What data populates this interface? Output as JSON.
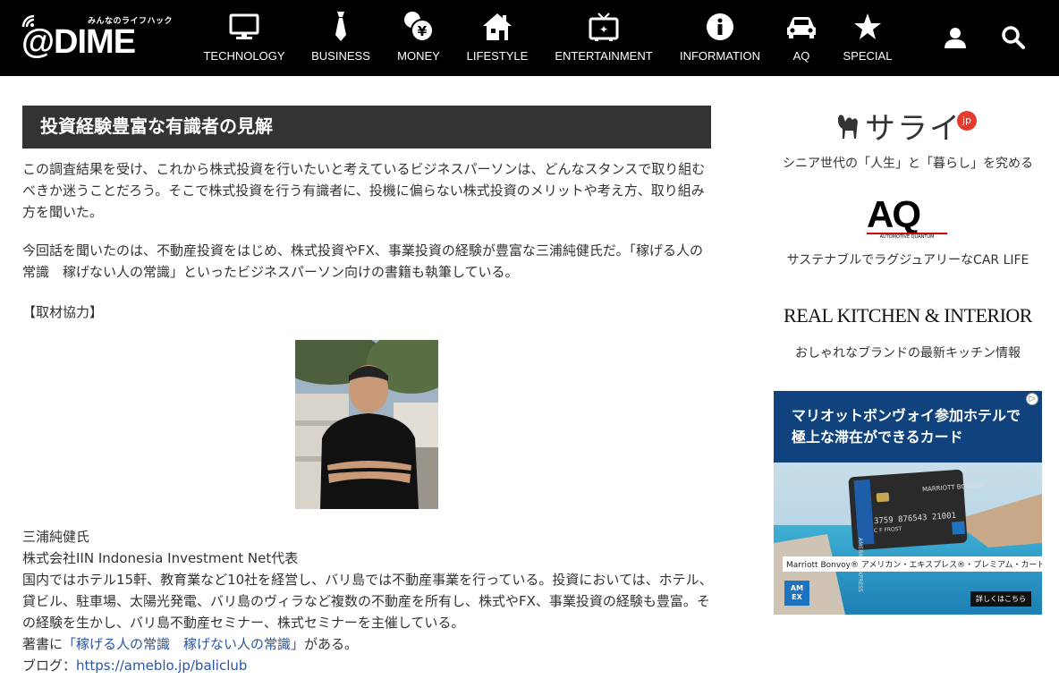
{
  "header": {
    "logo_tagline": "みんなのライフハック",
    "logo_text": "@DIME",
    "nav": [
      {
        "label": "TECHNOLOGY",
        "icon": "monitor-icon"
      },
      {
        "label": "BUSINESS",
        "icon": "necktie-icon"
      },
      {
        "label": "MONEY",
        "icon": "coin-yen-icon"
      },
      {
        "label": "LIFESTYLE",
        "icon": "house-icon"
      },
      {
        "label": "ENTERTAINMENT",
        "icon": "tv-icon"
      },
      {
        "label": "INFORMATION",
        "icon": "info-icon"
      },
      {
        "label": "AQ",
        "icon": "car-icon"
      },
      {
        "label": "SPECIAL",
        "icon": "star-icon"
      }
    ],
    "user_icon": "user-icon",
    "search_icon": "search-icon"
  },
  "article": {
    "heading": "投資経験豊富な有識者の見解",
    "para1": "この調査結果を受け、これから株式投資を行いたいと考えているビジネスパーソンは、どんなスタンスで取り組むべきか迷うことだろう。そこで株式投資を行う有識者に、投機に偏らない株式投資のメリットや考え方、取り組み方を聞いた。",
    "para2": "今回話を聞いたのは、不動産投資をはじめ、株式投資やFX、事業投資の経験が豊富な三浦純健氏だ。「稼げる人の常識　稼げない人の常識」といったビジネスパーソン向けの書籍も執筆している。",
    "cooperation": "【取材協力】",
    "profile": {
      "name": "三浦純健氏",
      "company": "株式会社IIN Indonesia Investment Net代表",
      "bio": "国内ではホテル15軒、教育業など10社を経営し、バリ島では不動産事業を行っている。投資においては、ホテル、貸ビル、駐車場、太陽光発電、バリ島のヴィラなど複数の不動産を所有し、株式やFX、事業投資の経験も豊富。その経験を生かし、バリ島不動産セミナー、株式セミナーを主催している。",
      "book_prefix": "著書に",
      "book_link": "「稼げる人の常識　稼げない人の常識」",
      "book_suffix": "がある。",
      "blog_prefix": "ブログ：",
      "blog_url": "https://ameblo.jp/baliclub"
    }
  },
  "sidebar": {
    "sarai": {
      "logo": "サライ",
      "jp_badge": "jp",
      "caption": "シニア世代の「人生」と「暮らし」を究める"
    },
    "aq": {
      "logo": "AQ",
      "sub": "AUTOMOTIVE QUANTUM",
      "caption": "サステナブルでラグジュアリーなCAR LIFE"
    },
    "rki": {
      "logo": "REAL KITCHEN & INTERIOR",
      "caption": "おしゃれなブランドの最新キッチン情報"
    },
    "ad": {
      "headline_line1": "マリオットボンヴォイ参加ホテルで",
      "headline_line2": "極上な滞在ができるカード",
      "card_brand": "MARRIOTT BONVOY",
      "card_number": "3759 876543 21001",
      "card_holder": "C F FROST",
      "card_network": "AMERICAN EXPRESS",
      "bottom_label": "Marriott Bonvoy® アメリカン・エキスプレス®・プレミアム・カード",
      "amex_logo": "AM EX",
      "cta": "詳しくはこちら"
    }
  }
}
